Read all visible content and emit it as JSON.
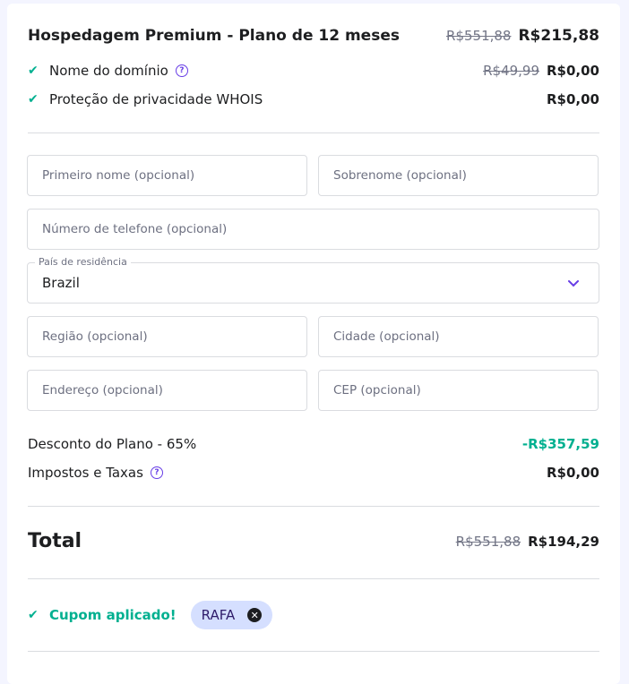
{
  "plan": {
    "title": "Hospedagem Premium - Plano de 12 meses",
    "old_price": "R$551,88",
    "price": "R$215,88"
  },
  "items": [
    {
      "label": "Nome do domínio",
      "old_price": "R$49,99",
      "price": "R$0,00"
    },
    {
      "label": "Proteção de privacidade WHOIS",
      "price": "R$0,00"
    }
  ],
  "form": {
    "first_name_placeholder": "Primeiro nome (opcional)",
    "last_name_placeholder": "Sobrenome (opcional)",
    "phone_placeholder": "Número de telefone (opcional)",
    "country_label": "País de residência",
    "country_value": "Brazil",
    "region_placeholder": "Região (opcional)",
    "city_placeholder": "Cidade (opcional)",
    "address_placeholder": "Endereço (opcional)",
    "zip_placeholder": "CEP (opcional)"
  },
  "summary": {
    "discount_label": "Desconto do Plano - 65%",
    "discount_value": "-R$357,59",
    "taxes_label": "Impostos e Taxas",
    "taxes_value": "R$0,00"
  },
  "total": {
    "label": "Total",
    "old_price": "R$551,88",
    "price": "R$194,29"
  },
  "coupon": {
    "label": "Cupom aplicado!",
    "code": "RAFA"
  },
  "colors": {
    "accent": "#673de6",
    "success": "#00b090"
  },
  "icons": {
    "check": "check-icon",
    "help": "help-icon",
    "chevron": "chevron-down-icon",
    "remove": "close-icon"
  }
}
